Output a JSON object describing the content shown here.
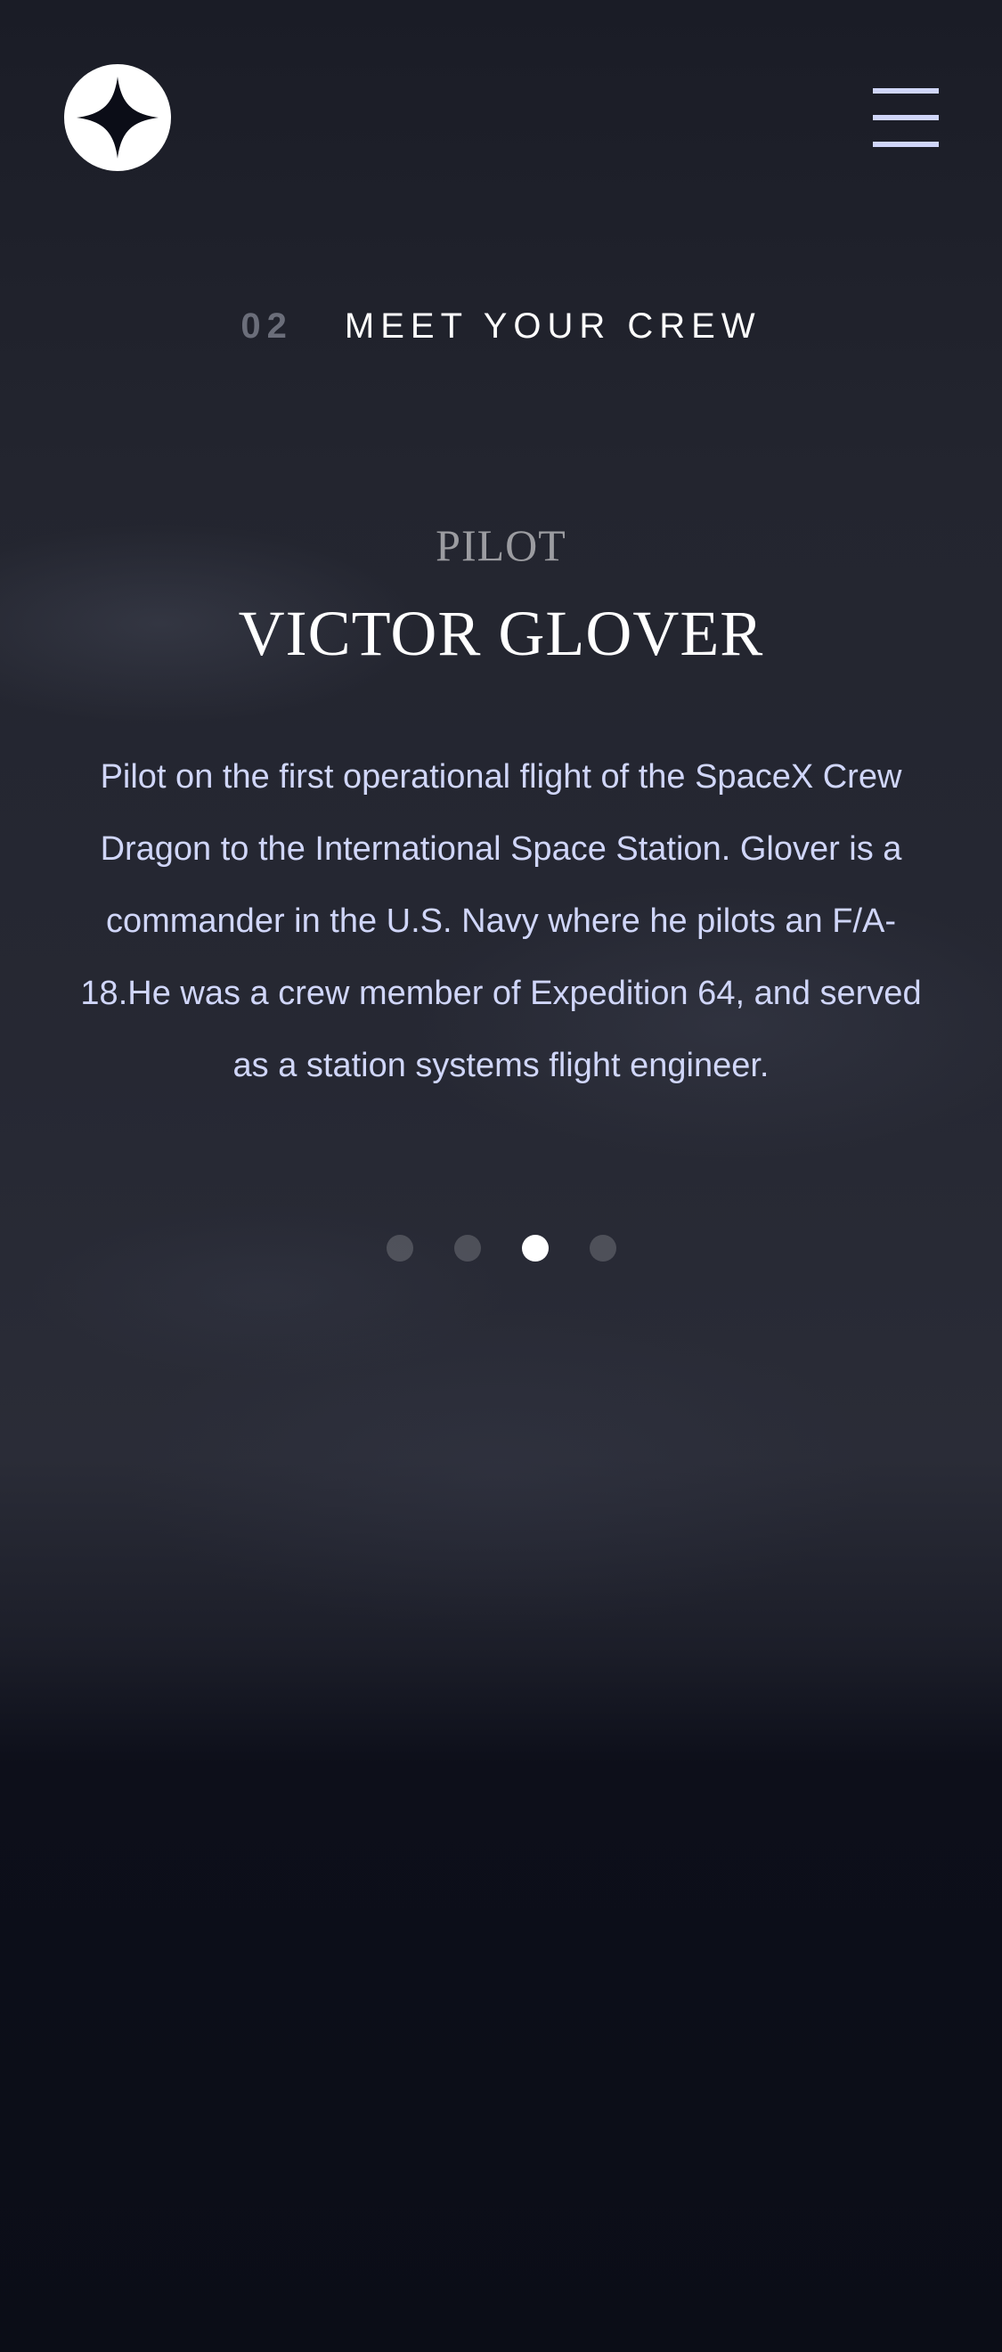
{
  "header": {
    "logo_icon": "four-point-star-logo-icon",
    "menu_icon": "hamburger-menu-icon"
  },
  "section": {
    "number": "02",
    "title": "MEET YOUR CREW"
  },
  "crew": {
    "role": "PILOT",
    "name": "VICTOR GLOVER",
    "bio": "Pilot on the first operational flight of the SpaceX Crew Dragon to the International Space Station. Glover is a commander in the U.S. Navy where he pilots an F/A-18.He was a crew member of Expedition 64, and served as a station systems flight engineer."
  },
  "carousel": {
    "total": 4,
    "active_index": 2
  },
  "colors": {
    "background": "#0b0d17",
    "accent_text": "#d0d6f9",
    "muted_number": "#6b6e7a",
    "white": "#ffffff"
  }
}
